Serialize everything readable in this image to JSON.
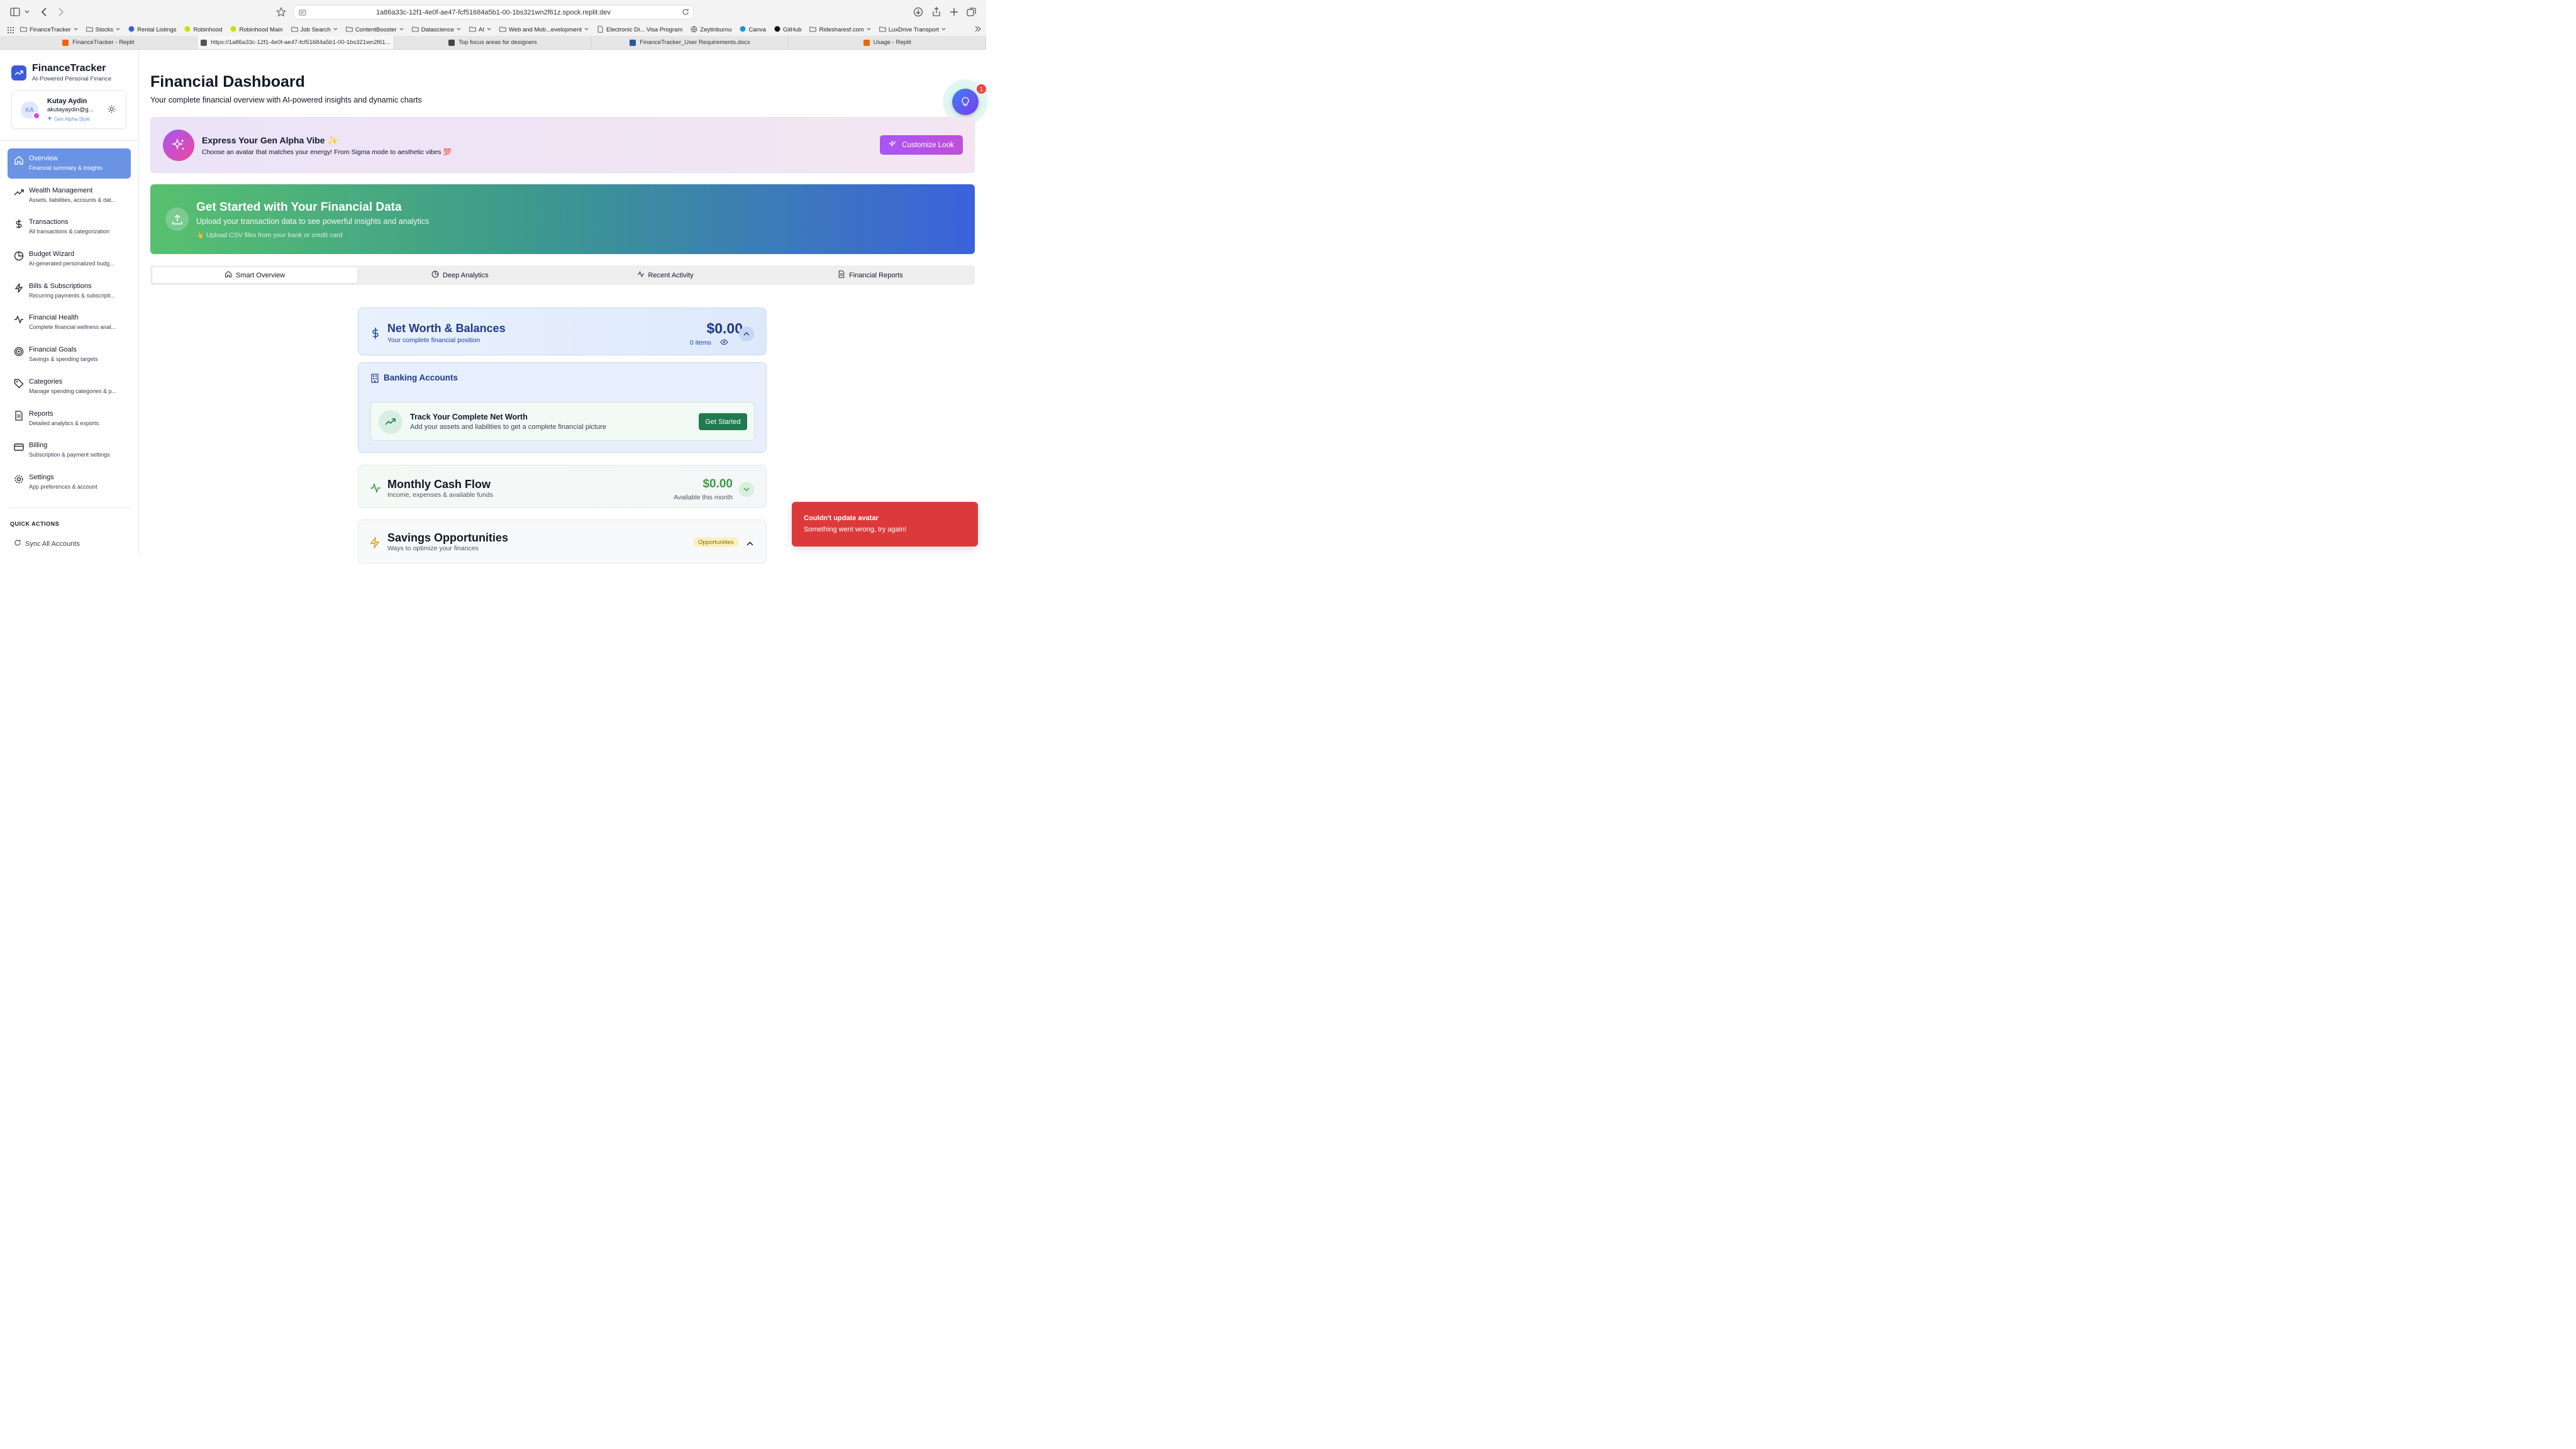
{
  "browser": {
    "url": "1a86a33c-12f1-4e0f-ae47-fcf51684a5b1-00-1bs321wn2f61z.spock.replit.dev",
    "bookmarks": [
      {
        "label": "FinanceTracker",
        "icon": "folder-icon",
        "dropdown": true
      },
      {
        "label": "Stocks",
        "icon": "folder-icon",
        "dropdown": true
      },
      {
        "label": "Rental Listings",
        "icon": "rental-icon",
        "dropdown": false
      },
      {
        "label": "Robinhood",
        "icon": "robinhood-icon",
        "dropdown": false
      },
      {
        "label": "Robinhood Main",
        "icon": "robinhood-icon",
        "dropdown": false
      },
      {
        "label": "Job Search",
        "icon": "folder-icon",
        "dropdown": true
      },
      {
        "label": "ContentBooster",
        "icon": "folder-icon",
        "dropdown": true
      },
      {
        "label": "Datascience",
        "icon": "folder-icon",
        "dropdown": true
      },
      {
        "label": "AI",
        "icon": "folder-icon",
        "dropdown": true
      },
      {
        "label": "Web and Mob...evelopment",
        "icon": "folder-icon",
        "dropdown": true
      },
      {
        "label": "Electronic Di... Visa Program",
        "icon": "document-icon",
        "dropdown": false
      },
      {
        "label": "Zeytinburnu",
        "icon": "globe-icon",
        "dropdown": false
      },
      {
        "label": "Canva",
        "icon": "canva-icon",
        "dropdown": false
      },
      {
        "label": "GitHub",
        "icon": "github-icon",
        "dropdown": false
      },
      {
        "label": "Ridesharesf.com",
        "icon": "folder-icon",
        "dropdown": true
      },
      {
        "label": "LuxDrive Transport",
        "icon": "folder-icon",
        "dropdown": true
      }
    ],
    "tabs": [
      {
        "label": "FinanceTracker - Replit",
        "active": false,
        "icon_color": "#f26207"
      },
      {
        "label": "https://1a86a33c-12f1-4e0f-ae47-fcf51684a5b1-00-1bs321wn2f61...",
        "active": true,
        "icon_color": "#555555"
      },
      {
        "label": "Top focus areas for designers",
        "active": false,
        "icon_color": "#444444"
      },
      {
        "label": "FinanceTracker_User Requirements.docx",
        "active": false,
        "icon_color": "#2b579a"
      },
      {
        "label": "Usage - Replit",
        "active": false,
        "icon_color": "#f26207"
      }
    ]
  },
  "sidebar": {
    "brand_title": "FinanceTracker",
    "brand_subtitle": "AI-Powered Personal Finance",
    "user": {
      "initials": "KA",
      "name": "Kutay Aydin",
      "email": "akutayaydin@g...",
      "style": "Gen Alpha Style"
    },
    "items": [
      {
        "label": "Overview",
        "desc": "Financial summary & insights",
        "icon": "home-icon",
        "active": true
      },
      {
        "label": "Wealth Management",
        "desc": "Assets, liabilities, accounts & dat...",
        "icon": "trending-up-icon",
        "active": false
      },
      {
        "label": "Transactions",
        "desc": "All transactions & categorization",
        "icon": "dollar-icon",
        "active": false
      },
      {
        "label": "Budget Wizard",
        "desc": "AI-generated personalized budg...",
        "icon": "pie-chart-icon",
        "active": false
      },
      {
        "label": "Bills & Subscriptions",
        "desc": "Recurring payments & subscripti...",
        "icon": "lightning-icon",
        "active": false
      },
      {
        "label": "Financial Health",
        "desc": "Complete financial wellness anal...",
        "icon": "activity-icon",
        "active": false
      },
      {
        "label": "Financial Goals",
        "desc": "Savings & spending targets",
        "icon": "target-icon",
        "active": false
      },
      {
        "label": "Categories",
        "desc": "Manage spending categories & p...",
        "icon": "tag-icon",
        "active": false
      },
      {
        "label": "Reports",
        "desc": "Detailed analytics & exports",
        "icon": "file-icon",
        "active": false
      },
      {
        "label": "Billing",
        "desc": "Subscription & payment settings",
        "icon": "credit-card-icon",
        "active": false
      },
      {
        "label": "Settings",
        "desc": "App preferences & account",
        "icon": "gear-icon",
        "active": false
      }
    ],
    "quick_actions_title": "QUICK ACTIONS",
    "quick_actions": [
      {
        "label": "Sync All Accounts",
        "icon": "refresh-icon"
      }
    ]
  },
  "main": {
    "title": "Financial Dashboard",
    "subtitle": "Your complete financial overview with AI-powered insights and dynamic charts",
    "notification_count": "1",
    "vibe": {
      "title": "Express Your Gen Alpha Vibe ✨",
      "subtitle": "Choose an avatar that matches your energy! From Sigma mode to aesthetic vibes 💯",
      "button": "Customize Look"
    },
    "get_started": {
      "title": "Get Started with Your Financial Data",
      "subtitle": "Upload your transaction data to see powerful insights and analytics",
      "hint": "👆 Upload CSV files from your bank or credit card"
    },
    "tabs": [
      {
        "label": "Smart Overview",
        "icon": "home-icon",
        "active": true
      },
      {
        "label": "Deep Analytics",
        "icon": "pie-chart-icon",
        "active": false
      },
      {
        "label": "Recent Activity",
        "icon": "activity-icon",
        "active": false
      },
      {
        "label": "Financial Reports",
        "icon": "file-icon",
        "active": false
      }
    ],
    "net_worth": {
      "title": "Net Worth & Balances",
      "subtitle": "Your complete financial position",
      "value": "$0.00",
      "items": "0 items"
    },
    "banking": {
      "title": "Banking Accounts",
      "track_title": "Track Your Complete Net Worth",
      "track_subtitle": "Add your assets and liabilities to get a complete financial picture",
      "button": "Get Started"
    },
    "cash_flow": {
      "title": "Monthly Cash Flow",
      "subtitle": "Income, expenses & available funds",
      "value": "$0.00",
      "value_label": "Available this month"
    },
    "savings": {
      "title": "Savings Opportunities",
      "subtitle": "Ways to optimize your finances",
      "badge": "Opportunities"
    }
  },
  "toast": {
    "title": "Couldn't update avatar",
    "message": "Something went wrong, try again!"
  },
  "colors": {
    "accent": "#3b5bdb",
    "nav_active": "#6b93e4",
    "success": "#217a4e",
    "error": "#dc3a3a"
  }
}
